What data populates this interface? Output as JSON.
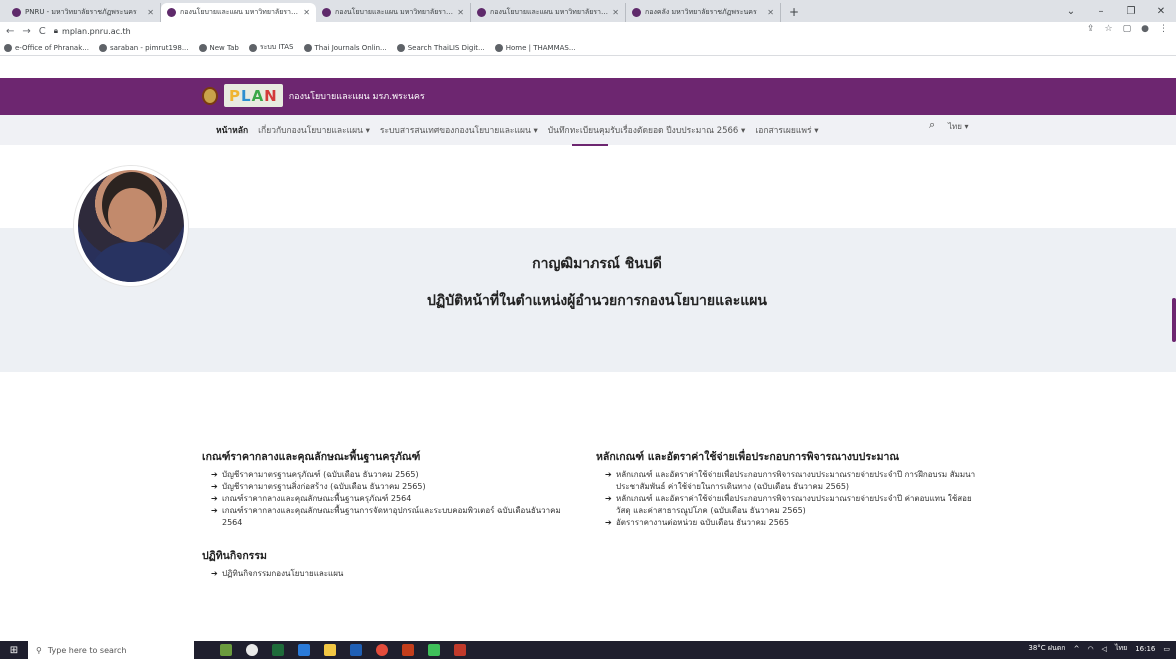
{
  "browser": {
    "tabs": [
      {
        "title": "PNRU - มหาวิทยาลัยราชภัฏพระนคร",
        "active": false
      },
      {
        "title": "กองนโยบายและแผน มหาวิทยาลัยราชภัฏพระนคร",
        "active": true
      },
      {
        "title": "กองนโยบายและแผน มหาวิทยาลัยราชภัฏพระนคร",
        "active": false
      },
      {
        "title": "กองนโยบายและแผน มหาวิทยาลัยราชภัฏพระนคร",
        "active": false
      },
      {
        "title": "กองคลัง มหาวิทยาลัยราชภัฏพระนคร",
        "active": false
      }
    ],
    "new_tab": "+",
    "url": "mplan.pnru.ac.th",
    "bookmarks": [
      "e-Office of Phranak...",
      "saraban - pimrut198...",
      "New Tab",
      "ระบบ ITAS",
      "Thai Journals Onlin...",
      "Search ThaiLIS Digit...",
      "Home | THAMMAS..."
    ]
  },
  "site": {
    "logo_letters": [
      "P",
      "L",
      "A",
      "N"
    ],
    "org_name": "กองนโยบายและแผน มรภ.พระนคร",
    "menu": [
      {
        "label": "หน้าหลัก",
        "active": true
      },
      {
        "label": "เกี่ยวกับกองนโยบายและแผน ▾",
        "active": false
      },
      {
        "label": "ระบบสารสนเทศของกองนโยบายและแผน ▾",
        "active": false
      },
      {
        "label": "บันทึกทะเบียนคุมรับเรื่องตัดยอด ปีงบประมาณ 2566 ▾",
        "active": false
      },
      {
        "label": "เอกสารเผยแพร่ ▾",
        "active": false
      }
    ],
    "lang": "ไทย ▾"
  },
  "profile": {
    "name": "กาญฒิมาภรณ์  ชินบดี",
    "role": "ปฏิบัติหน้าที่ในตำแหน่งผู้อำนวยการกองนโยบายและแผน"
  },
  "sections": {
    "left": {
      "title": "เกณฑ์ราคากลางและคุณลักษณะพื้นฐานครุภัณฑ์",
      "items": [
        "บัญชีราคามาตรฐานครุภัณฑ์ (ฉบับเดือน ธันวาคม 2565)",
        "บัญชีราคามาตรฐานสิ่งก่อสร้าง (ฉบับเดือน ธันวาคม 2565)",
        "เกณฑ์ราคากลางและคุณลักษณะพื้นฐานครุภัณฑ์ 2564",
        "เกณฑ์ราคากลางและคุณลักษณะพื้นฐานการจัดหาอุปกรณ์และระบบคอมพิวเตอร์ ฉบับเดือนธันวาคม 2564"
      ]
    },
    "right": {
      "title": "หลักเกณฑ์ และอัตราค่าใช้จ่ายเพื่อประกอบการพิจารณางบประมาณ",
      "items": [
        "หลักเกณฑ์ และอัตราค่าใช้จ่ายเพื่อประกอบการพิจารณางบประมาณรายจ่ายประจำปี การฝึกอบรม สัมมนา ประชาสัมพันธ์ ค่าใช้จ่ายในการเดินทาง (ฉบับเดือน ธันวาคม 2565)",
        "หลักเกณฑ์ และอัตราค่าใช้จ่ายเพื่อประกอบการพิจารณางบประมาณรายจ่ายประจำปี ค่าตอบแทน ใช้สอย วัสดุ และค่าสาธารณูปโภค (ฉบับเดือน ธันวาคม 2565)",
        "อัตราราคางานต่อหน่วย ฉบับเดือน ธันวาคม 2565"
      ]
    },
    "activity": {
      "title": "ปฏิทินกิจกรรม",
      "items": [
        "ปฏิทินกิจกรรมกองนโยบายและแผน"
      ]
    }
  },
  "taskbar": {
    "search_placeholder": "Type here to search",
    "weather": "38°C ฝนตก",
    "time": "16:16",
    "lang": "ไทย"
  }
}
